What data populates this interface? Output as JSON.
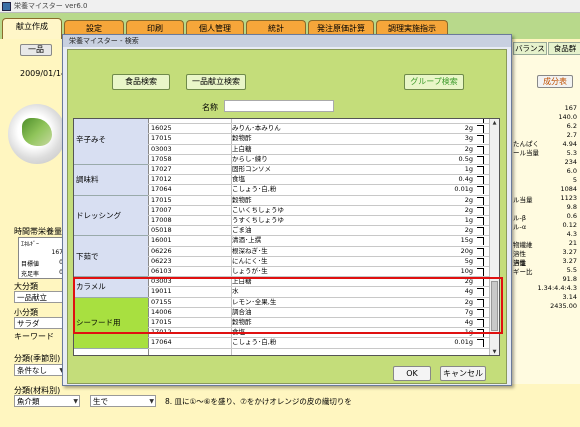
{
  "app_title": "栄養マイスター ver6.0",
  "main_tabs": [
    {
      "label": "献立作成",
      "active": true
    },
    {
      "label": "設定",
      "active": false
    },
    {
      "label": "印刷",
      "active": false
    },
    {
      "label": "個人管理",
      "active": false
    },
    {
      "label": "統計",
      "active": false
    },
    {
      "label": "発注原価計算",
      "active": false
    },
    {
      "label": "調理実施指示",
      "active": false
    }
  ],
  "main": {
    "ippin_button": "一品",
    "date": "2009/01/14",
    "nutrition_header": "時間帯栄養量",
    "mini_table": {
      "energy_label": "ｴﾈﾙｷﾞｰ",
      "energy_value": "167",
      "rows": [
        {
          "label": "目標値",
          "value": "0"
        },
        {
          "label": "充足率",
          "value": "0"
        }
      ]
    },
    "daibunrui_label": "大分類",
    "daibunrui_value": "一品献立",
    "shobunrui_label": "小分類",
    "shobunrui_value": "サラダ",
    "keyword_label": "キーワード",
    "season_label": "分類(季節別)",
    "season_value": "条件なし",
    "material_label": "分類(材料別)",
    "material_value": "魚介類",
    "bottom_select": "生で",
    "instruction": "8. 皿に①～⑥を盛り、⑦をかけオレンジの皮の繊切りを"
  },
  "right_panel": {
    "tabs": [
      "バランス",
      "食品群"
    ],
    "button": "成分表",
    "labels": [
      "たんぱく",
      "ール当量",
      "ル当量",
      "ル-β",
      "ル-α",
      "ギー比",
      "当量"
    ],
    "numbers": [
      "167",
      "140.0",
      "6.2",
      "2.7",
      "4.94",
      "5.3",
      "234",
      "6.0",
      "5",
      "1084",
      "1123",
      "9.8",
      "0.6",
      "0.12",
      "4.3",
      "21",
      "3.27",
      "3.27",
      "5.5",
      "91.8",
      "1.34:4.4:4.3",
      "3.14",
      "2435.00"
    ],
    "partial_labels": [
      "物繊維",
      "溶性",
      "溶性"
    ]
  },
  "dialog": {
    "title": "栄養マイスター - 検索",
    "food_search_button": "食品検索",
    "ippin_search_button": "一品献立検索",
    "group_search_button": "グループ検索",
    "name_label": "名称",
    "name_value": "",
    "ok_button": "OK",
    "cancel_button": "キャンセル",
    "groups": [
      {
        "name": "辛子みそ",
        "highlight": false,
        "rows": [
          {
            "code": "",
            "name": "",
            "amount": "",
            "partial": true
          },
          {
            "code": "16025",
            "name": "みりん･本みりん",
            "amount": "2g"
          },
          {
            "code": "17015",
            "name": "穀物酢",
            "amount": "3g"
          },
          {
            "code": "03003",
            "name": "上白糖",
            "amount": "2g"
          },
          {
            "code": "17058",
            "name": "からし･練り",
            "amount": "0.5g"
          }
        ]
      },
      {
        "name": "調味料",
        "highlight": false,
        "rows": [
          {
            "code": "17027",
            "name": "固形コンソメ",
            "amount": "1g"
          },
          {
            "code": "17012",
            "name": "食塩",
            "amount": "0.4g"
          },
          {
            "code": "17064",
            "name": "こしょう･白,粉",
            "amount": "0.01g"
          }
        ]
      },
      {
        "name": "ドレッシング",
        "highlight": false,
        "rows": [
          {
            "code": "17015",
            "name": "穀物酢",
            "amount": "2g"
          },
          {
            "code": "17007",
            "name": "こいくちしょうゆ",
            "amount": "2g"
          },
          {
            "code": "17008",
            "name": "うすくちしょうゆ",
            "amount": "1g"
          },
          {
            "code": "05018",
            "name": "ごま油",
            "amount": "2g"
          }
        ]
      },
      {
        "name": "下茹で",
        "highlight": false,
        "rows": [
          {
            "code": "16001",
            "name": "清酒･上撰",
            "amount": "15g"
          },
          {
            "code": "06226",
            "name": "根深ねぎ･生",
            "amount": "20g"
          },
          {
            "code": "06223",
            "name": "にんにく･生",
            "amount": "5g"
          },
          {
            "code": "06103",
            "name": "しょうが･生",
            "amount": "10g"
          }
        ]
      },
      {
        "name": "カラメル",
        "highlight": false,
        "rows": [
          {
            "code": "03003",
            "name": "上白糖",
            "amount": "2g"
          },
          {
            "code": "19011",
            "name": "水",
            "amount": "4g"
          }
        ]
      },
      {
        "name": "シーフード用",
        "highlight": true,
        "rows": [
          {
            "code": "07155",
            "name": "レモン･全果,生",
            "amount": "2g"
          },
          {
            "code": "14006",
            "name": "調合油",
            "amount": "7g"
          },
          {
            "code": "17015",
            "name": "穀物酢",
            "amount": "4g"
          },
          {
            "code": "17012",
            "name": "食塩",
            "amount": "1g"
          },
          {
            "code": "17064",
            "name": "こしょう･白,粉",
            "amount": "0.01g"
          }
        ]
      }
    ]
  }
}
